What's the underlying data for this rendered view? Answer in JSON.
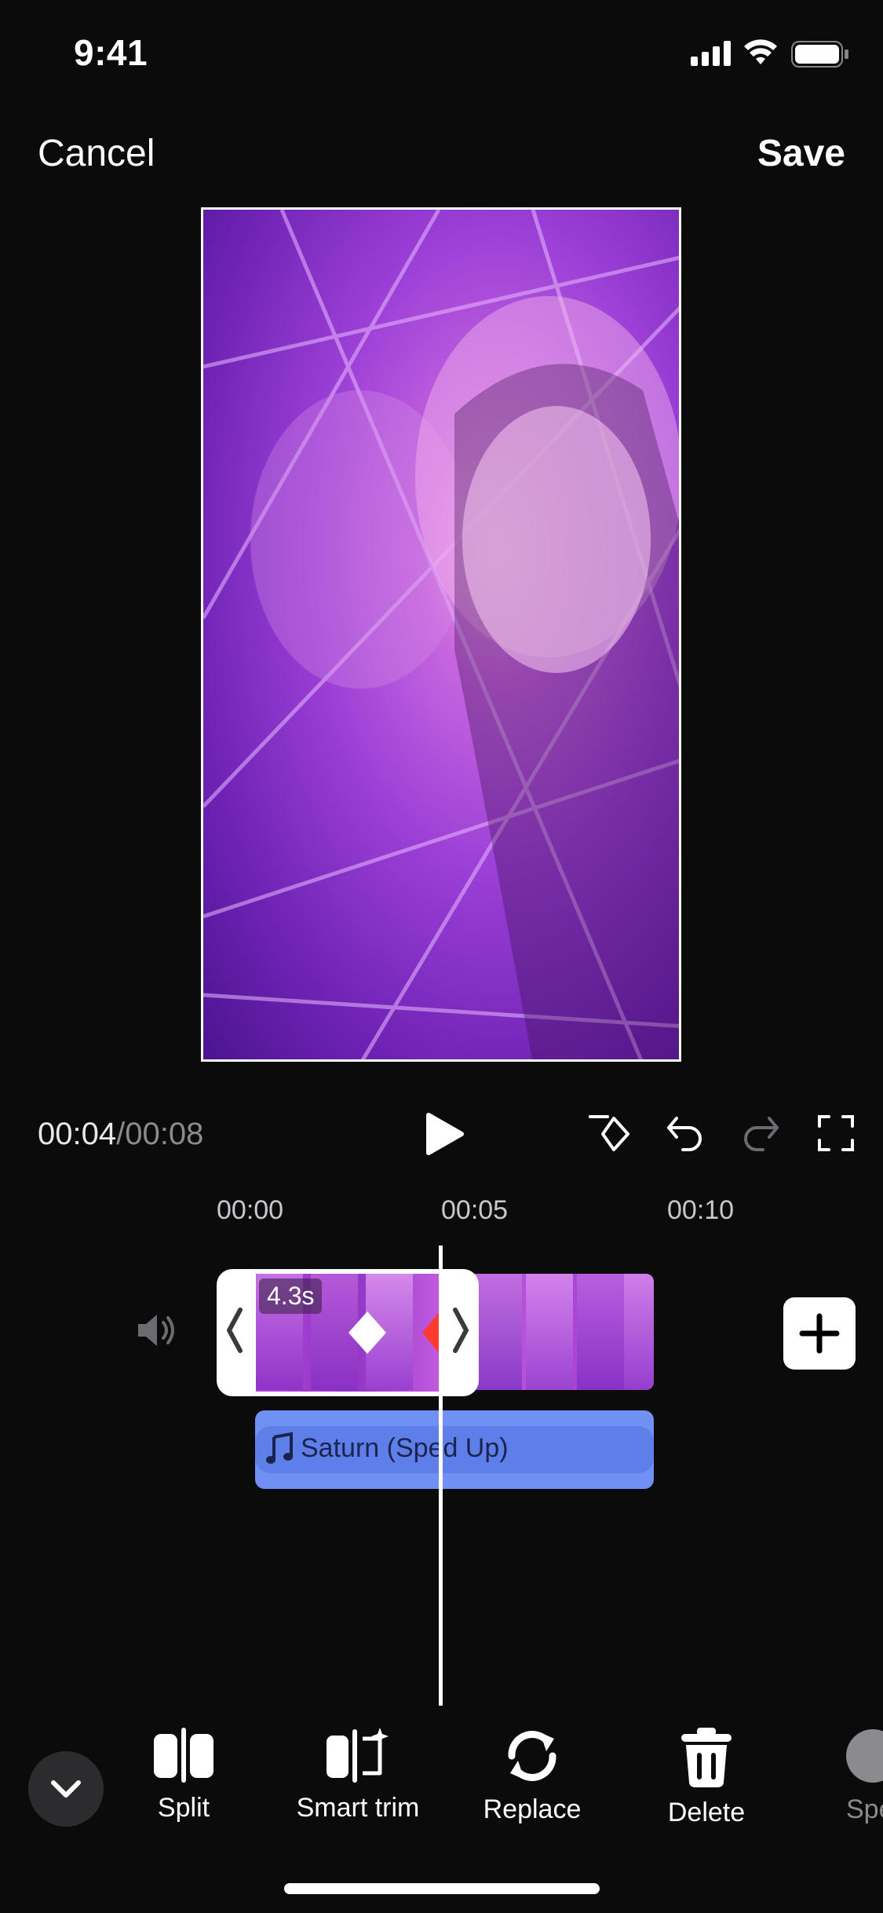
{
  "status": {
    "time": "9:41"
  },
  "header": {
    "cancel_label": "Cancel",
    "save_label": "Save"
  },
  "player": {
    "current_time": "00:04",
    "separator": "/",
    "total_time": "00:08"
  },
  "ruler": {
    "labels": [
      "00:00",
      "00:05",
      "00:10"
    ]
  },
  "timeline": {
    "selected_clip_duration": "4.3s",
    "audio_track_label": "Saturn (Sped Up)"
  },
  "toolbar": {
    "items": [
      {
        "label": "Split",
        "icon": "split-icon"
      },
      {
        "label": "Smart trim",
        "icon": "smart-trim-icon"
      },
      {
        "label": "Replace",
        "icon": "replace-icon"
      },
      {
        "label": "Delete",
        "icon": "trash-icon"
      },
      {
        "label": "Spe",
        "icon": "speed-icon"
      }
    ]
  }
}
